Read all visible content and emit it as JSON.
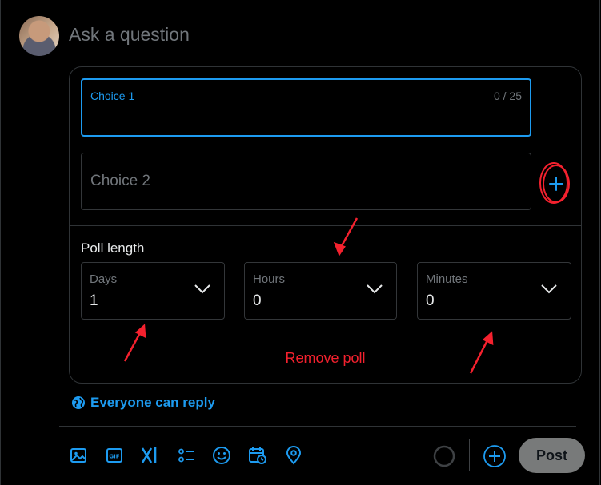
{
  "composer": {
    "placeholder": "Ask a question"
  },
  "poll": {
    "choice1": {
      "label": "Choice 1",
      "counter": "0 / 25",
      "value": ""
    },
    "choice2": {
      "placeholder": "Choice 2",
      "value": ""
    },
    "add_choice_icon": "plus-icon",
    "length_label": "Poll length",
    "days": {
      "label": "Days",
      "value": "1"
    },
    "hours": {
      "label": "Hours",
      "value": "0"
    },
    "minutes": {
      "label": "Minutes",
      "value": "0"
    },
    "remove_label": "Remove poll"
  },
  "reply_setting": {
    "label": "Everyone can reply",
    "icon": "globe-icon"
  },
  "toolbar": {
    "icons": [
      "image-icon",
      "gif-icon",
      "grok-icon",
      "poll-icon",
      "emoji-icon",
      "schedule-icon",
      "location-icon"
    ]
  },
  "post_button": {
    "label": "Post"
  },
  "colors": {
    "accent": "#1d9bf0",
    "danger": "#f4212e",
    "background": "#000000",
    "border": "#2f3336"
  },
  "annotations": {
    "highlight_color": "#f4212e",
    "arrows": 3,
    "circled": "add-choice-button"
  }
}
